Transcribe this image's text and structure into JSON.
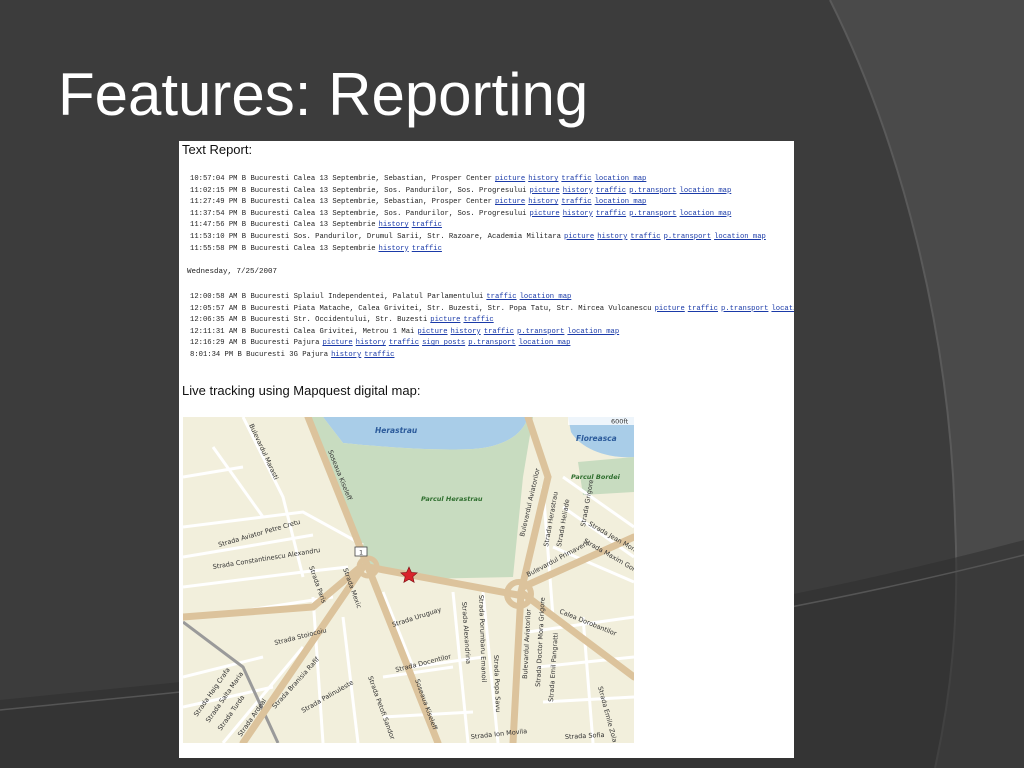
{
  "slide": {
    "title": "Features: Reporting"
  },
  "report": {
    "heading": "Text Report:",
    "date_header": "Wednesday, 7/25/2007",
    "entries_before": [
      {
        "time": "10:57:04 PM",
        "plate": "B",
        "text": "Bucuresti Calea 13 Septembrie, Sebastian, Prosper Center",
        "links": [
          "picture",
          "history",
          "traffic",
          "location map"
        ]
      },
      {
        "time": "11:02:15 PM",
        "plate": "B",
        "text": "Bucuresti Calea 13 Septembrie, Sos. Pandurilor, Sos. Progresului",
        "links": [
          "picture",
          "history",
          "traffic",
          "p.transport",
          "location map"
        ]
      },
      {
        "time": "11:27:49 PM",
        "plate": "B",
        "text": "Bucuresti Calea 13 Septembrie, Sebastian, Prosper Center",
        "links": [
          "picture",
          "history",
          "traffic",
          "location map"
        ]
      },
      {
        "time": "11:37:54 PM",
        "plate": "B",
        "text": "Bucuresti Calea 13 Septembrie, Sos. Pandurilor, Sos. Progresului",
        "links": [
          "picture",
          "history",
          "traffic",
          "p.transport",
          "location map"
        ]
      },
      {
        "time": "11:47:56 PM",
        "plate": "B",
        "text": "Bucuresti Calea 13 Septembrie",
        "links": [
          "history",
          "traffic"
        ]
      },
      {
        "time": "11:53:10 PM",
        "plate": "B",
        "text": "Bucuresti Sos. Pandurilor, Drumul Sarii, Str. Razoare, Academia Militara",
        "links": [
          "picture",
          "history",
          "traffic",
          "p.transport",
          "location map"
        ]
      },
      {
        "time": "11:55:58 PM",
        "plate": "B",
        "text": "Bucuresti Calea 13 Septembrie",
        "links": [
          "history",
          "traffic"
        ]
      }
    ],
    "entries_after": [
      {
        "time": "12:00:58 AM",
        "plate": "B",
        "text": "Bucuresti Splaiul Independentei, Palatul Parlamentului",
        "links": [
          "traffic",
          "location map"
        ]
      },
      {
        "time": "12:05:57 AM",
        "plate": "B",
        "text": "Bucuresti Piata Matache, Calea Grivitei, Str. Buzesti, Str. Popa Tatu, Str. Mircea Vulcanescu",
        "links": [
          "picture",
          "traffic",
          "p.transport",
          "location"
        ]
      },
      {
        "time": "12:06:35 AM",
        "plate": "B",
        "text": "Bucuresti Str. Occidentului, Str. Buzesti",
        "links": [
          "picture",
          "traffic"
        ]
      },
      {
        "time": "12:11:31 AM",
        "plate": "B",
        "text": "Bucuresti Calea Grivitei, Metrou 1 Mai",
        "links": [
          "picture",
          "history",
          "traffic",
          "p.transport",
          "location map"
        ]
      },
      {
        "time": "12:16:29 AM",
        "plate": "B",
        "text": "Bucuresti Pajura",
        "links": [
          "picture",
          "history",
          "traffic",
          "sign posts",
          "p.transport",
          "location map"
        ]
      },
      {
        "time": "8:01:34 PM",
        "plate": "B",
        "text": "Bucuresti 3G Pajura",
        "links": [
          "history",
          "traffic"
        ]
      }
    ]
  },
  "live": {
    "heading": "Live tracking using Mapquest digital map:"
  },
  "map": {
    "scale_label": "600ft",
    "labels": {
      "herastrau": "Herastrau",
      "floreasca": "Floreasca",
      "parcul_bordei": "Parcul Bordei",
      "parcul_herastrau": "Parcul Herastrau",
      "bd_aviatorilor": "Bulevardul Aviatorilor",
      "bd_aviatorilor_south": "Bulevardul Aviatorilor",
      "sos_kiseleff": "Soseaua Kiseleff",
      "sos_kiseleff_south": "Soseaua Kiseleff",
      "bd_marasti": "Bulevardul Marasti",
      "str_aviator_petre_cretu": "Strada Aviator Petre Cretu",
      "str_constantinescu": "Strada Constantinescu Alexandru",
      "str_uruguay": "Strada Uruguay",
      "str_alexandrina": "Strada Alexandrina",
      "str_porumbaru": "Strada Porumbaru Emanoil",
      "str_popa_savu": "Strada Popa Savu",
      "str_mora": "Strada Doctor Mora Grigore",
      "calea_dorobantilor": "Calea Dorobantilor",
      "str_docentilor": "Strada Docentilor",
      "str_stoiocoiu": "Strada Stoiocoiu",
      "str_mexic": "Strada Mexic",
      "str_paris": "Strada Paris",
      "str_herastrau": "Strada Herastrau",
      "str_heliade": "Strada Heliade",
      "str_grigore_mora_2": "Strada Grigore",
      "str_ion_movila": "Strada Ion Movila",
      "str_sofia": "Strada Sofia",
      "str_emil_pangratti": "Strada Emil Pangratti",
      "str_emile_zola": "Strada Emile Zola",
      "str_jean_monnet": "Strada Jean Monnet",
      "str_maxim_gorki": "Strada Maxim Gorki",
      "str_primaverii": "Bulevardul Primaverii",
      "str_haig": "Strada Haig Crafa",
      "str_fabrica": "Strada Salta Maria",
      "str_turda": "Strada Turda",
      "str_paris_short": "Strada Paris",
      "str_ardeal": "Strada Ardeal",
      "str_roosevelt": "Strada Roosevelt",
      "str_buzesti": "Strada Branisia Rafif",
      "str_pasarelle": "Strada Palinuleste",
      "str_petofi": "Strada Petofi Sandor",
      "str_kiseleff_marker": "1"
    },
    "colors": {
      "park": "#c8dcc0",
      "water": "#a9cde8",
      "land": "#f2efdc",
      "road_major": "#dcc39c",
      "road_minor": "#ffffff",
      "marker": "#d8232a"
    }
  }
}
